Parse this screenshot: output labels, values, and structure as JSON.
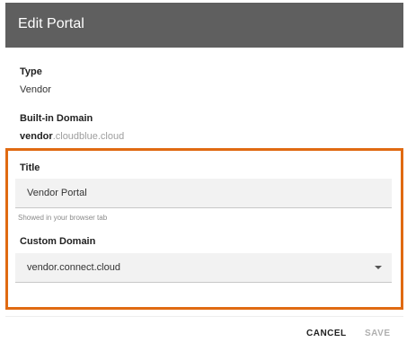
{
  "dialog": {
    "title": "Edit Portal"
  },
  "type": {
    "label": "Type",
    "value": "Vendor"
  },
  "builtin_domain": {
    "label": "Built-in Domain",
    "prefix": "vendor",
    "suffix": ".cloudblue.cloud"
  },
  "title_field": {
    "label": "Title",
    "value": "Vendor Portal",
    "helper": "Showed in your browser tab"
  },
  "custom_domain": {
    "label": "Custom Domain",
    "selected": "vendor.connect.cloud"
  },
  "actions": {
    "cancel_label": "CANCEL",
    "save_label": "SAVE"
  },
  "colors": {
    "header_bg": "#5f5f5f",
    "highlight_border": "#e06a12"
  }
}
